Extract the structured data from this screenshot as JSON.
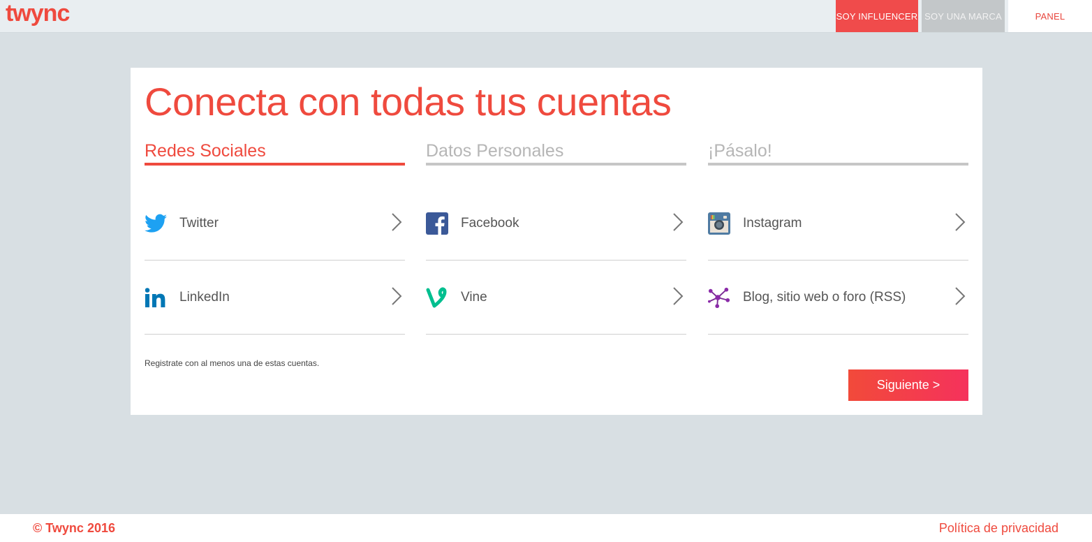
{
  "brand": {
    "logo_text": "twync",
    "accent_color": "#ef4a3e"
  },
  "nav": {
    "influencer": "SOY INFLUENCER",
    "marca": "SOY UNA MARCA",
    "panel": "PANEL"
  },
  "main": {
    "title": "Conecta con todas tus cuentas",
    "steps": [
      {
        "label": "Redes Sociales",
        "active": true
      },
      {
        "label": "Datos Personales",
        "active": false
      },
      {
        "label": "¡Pásalo!",
        "active": false
      }
    ],
    "accounts": [
      {
        "label": "Twitter",
        "icon": "twitter-icon"
      },
      {
        "label": "Facebook",
        "icon": "facebook-icon"
      },
      {
        "label": "Instagram",
        "icon": "instagram-icon"
      },
      {
        "label": "LinkedIn",
        "icon": "linkedin-icon"
      },
      {
        "label": "Vine",
        "icon": "vine-icon"
      },
      {
        "label": "Blog, sitio web o foro (RSS)",
        "icon": "rss-network-icon"
      }
    ],
    "note": "Registrate con al menos una de estas cuentas.",
    "next_label": "Siguiente >"
  },
  "footer": {
    "copyright": "© Twync 2016",
    "privacy": "Política de privacidad"
  }
}
